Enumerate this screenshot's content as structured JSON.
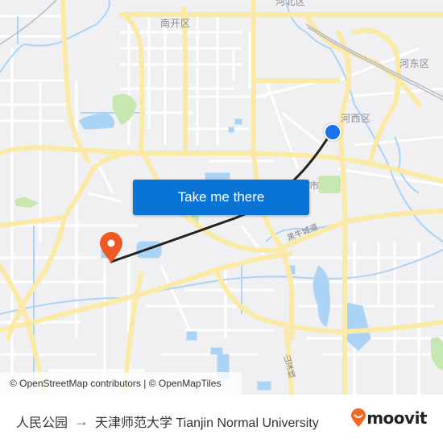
{
  "map": {
    "districts": [
      {
        "name": "南开区"
      },
      {
        "name": "河北区"
      },
      {
        "name": "河东区"
      },
      {
        "name": "河西区"
      },
      {
        "name": "市"
      }
    ],
    "road_labels": [
      {
        "name": "黑牛城道"
      },
      {
        "name": "山深线"
      }
    ],
    "origin_marker": {
      "label": "人民公园",
      "color": "#1a73e8"
    },
    "destination_marker": {
      "label": "天津师范大学 Tianjin Normal University",
      "color": "#ee5a24"
    },
    "route_color": "#222222",
    "attribution": "© OpenStreetMap contributors | © OpenMapTiles"
  },
  "cta": {
    "label": "Take me there",
    "color": "#0a74d6"
  },
  "footer": {
    "origin": "人民公园",
    "arrow": "→",
    "destination": "天津师范大学 Tianjin Normal University",
    "brand": "moovit",
    "brand_color": "#f26522"
  },
  "colors": {
    "map_bg": "#f0f0f2",
    "major_road": "#fbe9a6",
    "minor_road": "#ffffff",
    "water": "#aad3f5",
    "park": "#c8e6b0"
  }
}
